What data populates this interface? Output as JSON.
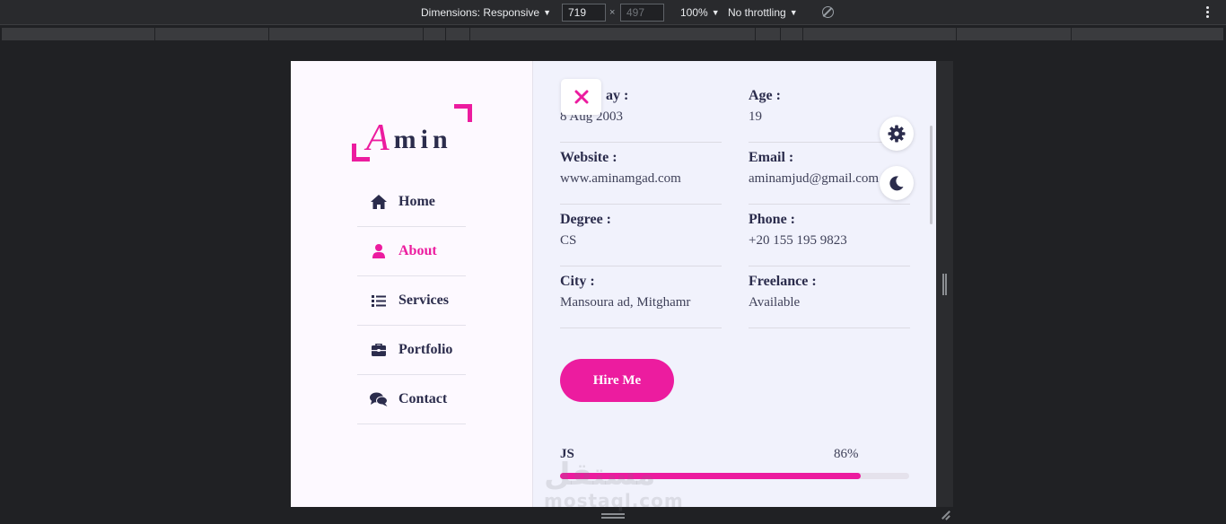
{
  "devtools": {
    "dimensions_label": "Dimensions: Responsive",
    "width": "719",
    "height_placeholder": "497",
    "times": "×",
    "zoom": "100%",
    "throttling": "No throttling"
  },
  "sidebar": {
    "logo": {
      "initial": "A",
      "rest": "min"
    },
    "items": [
      {
        "label": "Home",
        "icon": "home-icon"
      },
      {
        "label": "About",
        "icon": "user-icon",
        "active": true
      },
      {
        "label": "Services",
        "icon": "list-icon"
      },
      {
        "label": "Portfolio",
        "icon": "briefcase-icon"
      },
      {
        "label": "Contact",
        "icon": "comments-icon"
      }
    ]
  },
  "info": {
    "birthday": {
      "label": "Birthday :",
      "visible_label": "ay :",
      "value": "8 Aug 2003"
    },
    "age": {
      "label": "Age :",
      "value": "19"
    },
    "website": {
      "label": "Website :",
      "value": "www.aminamgad.com"
    },
    "email": {
      "label": "Email :",
      "value": "aminamjud@gmail.com"
    },
    "degree": {
      "label": "Degree :",
      "value": "CS"
    },
    "phone": {
      "label": "Phone :",
      "value": "+20 155 195 9823"
    },
    "city": {
      "label": "City :",
      "value": "Mansoura ad, Mitghamr"
    },
    "freelance": {
      "label": "Freelance :",
      "value": "Available"
    }
  },
  "hire_label": "Hire Me",
  "skills": [
    {
      "name": "JS",
      "percent_label": "86%",
      "percent": 0.86
    }
  ],
  "watermark": {
    "arabic": "مستقل",
    "latin": "mostaql.com"
  },
  "colors": {
    "accent": "#ec1c9f",
    "text": "#2b2c4c",
    "page_bg": "#f1f2fc",
    "sidebar_bg": "#fdf9ff"
  }
}
